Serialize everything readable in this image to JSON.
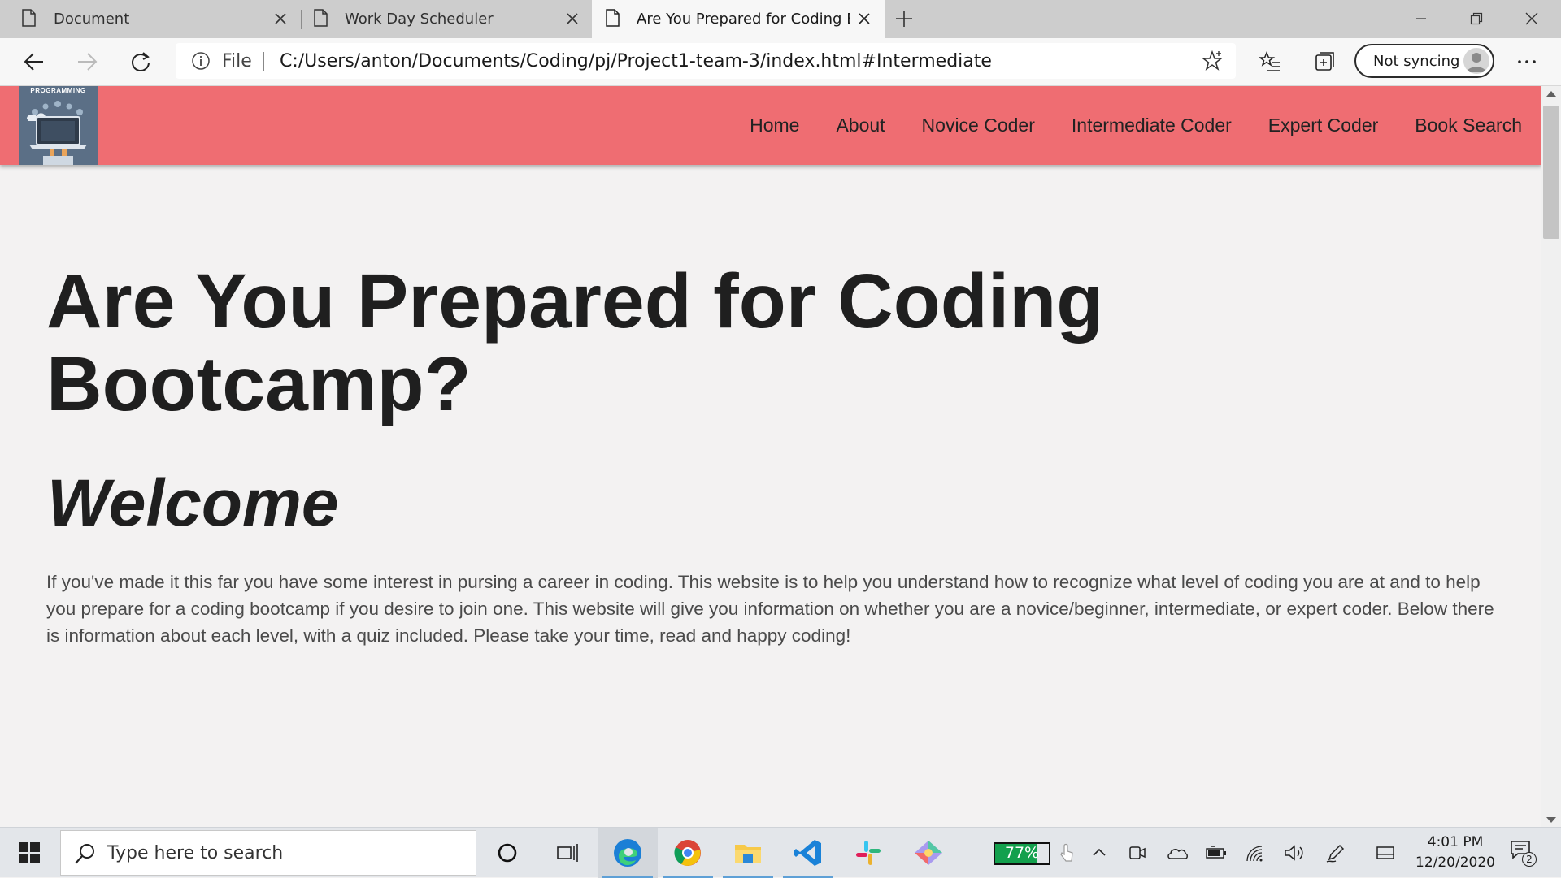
{
  "browser": {
    "tabs": [
      {
        "title": "Document",
        "active": false
      },
      {
        "title": "Work Day Scheduler",
        "active": false
      },
      {
        "title": "Are You Prepared for Coding Boc",
        "active": true
      }
    ],
    "address": {
      "scheme_label": "File",
      "url": "C:/Users/anton/Documents/Coding/pj/Project1-team-3/index.html#Intermediate"
    },
    "profile_label": "Not syncing"
  },
  "page": {
    "logo_text": "PROGRAMMING",
    "nav": [
      "Home",
      "About",
      "Novice Coder",
      "Intermediate Coder",
      "Expert Coder",
      "Book Search"
    ],
    "title": "Are You Prepared for Coding Bootcamp?",
    "subtitle": "Welcome",
    "intro": "If you've made it this far you have some interest in pursing a career in coding. This website is to help you understand how to recognize what level of coding you are at and to help you prepare for a coding bootcamp if you desire to join one. This website will give you information on whether you are a novice/beginner, intermediate, or expert coder. Below there is information about each level, with a quiz included. Please take your time, read and happy coding!",
    "colors": {
      "navbar": "#ef6d72",
      "background": "#f3f2f2"
    }
  },
  "taskbar": {
    "search_placeholder": "Type here to search",
    "battery": {
      "label": "77%",
      "level": 0.77
    },
    "time": "4:01 PM",
    "date": "12/20/2020",
    "notification_count": "2",
    "apps": [
      "task-view",
      "edge",
      "chrome",
      "file-explorer",
      "vscode",
      "slack",
      "gitkraken"
    ]
  }
}
